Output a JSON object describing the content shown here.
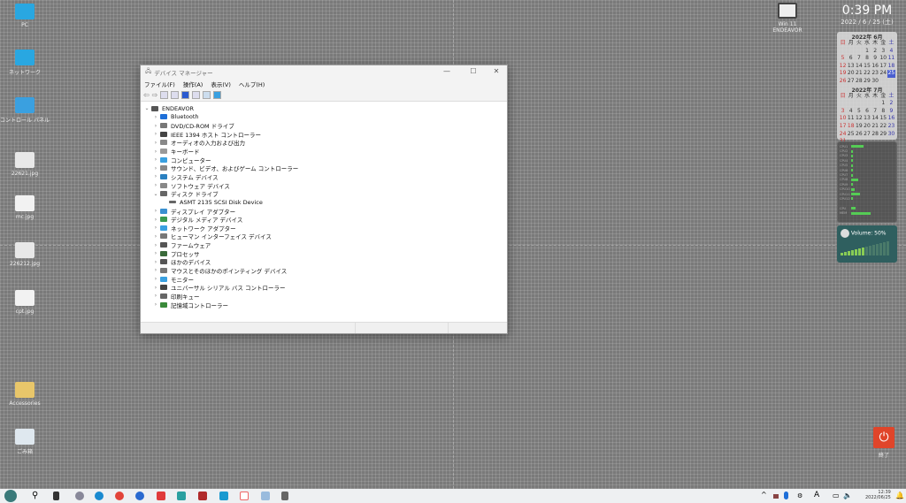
{
  "desktop": {
    "icons_left": [
      {
        "label": "PC",
        "color": "#29a7e1"
      },
      {
        "label": "ネットワーク",
        "color": "#29a7e1"
      },
      {
        "label": "コントロール パネル",
        "color": "#3aa0e0"
      },
      {
        "label": "22621.jpg",
        "color": "#e8e8e8"
      },
      {
        "label": "mc.jpg",
        "color": "#f2f2f2"
      },
      {
        "label": "226212.jpg",
        "color": "#e8e8e8"
      },
      {
        "label": "cpt.jpg",
        "color": "#f2f2f2"
      },
      {
        "label": "Accessories",
        "color": "#e8c66a"
      },
      {
        "label": "ごみ箱",
        "color": "#dfe8ef"
      }
    ],
    "icon_right": {
      "label": "Win 11 ENDEAVOR"
    },
    "power_icon": {
      "label": "終了",
      "color": "#e0452a"
    }
  },
  "window": {
    "title": "デバイス マネージャー",
    "minimize": "—",
    "maximize": "☐",
    "close": "✕",
    "menu": [
      "ファイル(F)",
      "操作(A)",
      "表示(V)",
      "ヘルプ(H)"
    ],
    "tree": {
      "root": "ENDEAVOR",
      "items": [
        {
          "label": "Bluetooth",
          "expanded": false,
          "color": "#1e6fd8"
        },
        {
          "label": "DVD/CD-ROM ドライブ",
          "expanded": false,
          "color": "#777"
        },
        {
          "label": "IEEE 1394 ホスト コントローラー",
          "expanded": false,
          "color": "#444"
        },
        {
          "label": "オーディオの入力および出力",
          "expanded": false,
          "color": "#888"
        },
        {
          "label": "キーボード",
          "expanded": false,
          "color": "#999"
        },
        {
          "label": "コンピューター",
          "expanded": false,
          "color": "#3aa0e0"
        },
        {
          "label": "サウンド、ビデオ、およびゲーム コントローラー",
          "expanded": false,
          "color": "#888"
        },
        {
          "label": "システム デバイス",
          "expanded": false,
          "color": "#2a80c0"
        },
        {
          "label": "ソフトウェア デバイス",
          "expanded": false,
          "color": "#888"
        },
        {
          "label": "ディスク ドライブ",
          "expanded": true,
          "color": "#666",
          "children": [
            "ASMT 2135 SCSI Disk Device"
          ]
        },
        {
          "label": "ディスプレイ アダプター",
          "expanded": false,
          "color": "#3a90d0"
        },
        {
          "label": "デジタル メディア デバイス",
          "expanded": false,
          "color": "#3a9a50"
        },
        {
          "label": "ネットワーク アダプター",
          "expanded": false,
          "color": "#3aa0e0"
        },
        {
          "label": "ヒューマン インターフェイス デバイス",
          "expanded": false,
          "color": "#777"
        },
        {
          "label": "ファームウェア",
          "expanded": false,
          "color": "#555"
        },
        {
          "label": "プロセッサ",
          "expanded": false,
          "color": "#3a6a3a"
        },
        {
          "label": "ほかのデバイス",
          "expanded": false,
          "color": "#555"
        },
        {
          "label": "マウスとそのほかのポインティング デバイス",
          "expanded": false,
          "color": "#777"
        },
        {
          "label": "モニター",
          "expanded": false,
          "color": "#3aa0e0"
        },
        {
          "label": "ユニバーサル シリアル バス コントローラー",
          "expanded": false,
          "color": "#444"
        },
        {
          "label": "印刷キュー",
          "expanded": false,
          "color": "#666"
        },
        {
          "label": "記憶域コントローラー",
          "expanded": false,
          "color": "#3a8a3a"
        }
      ]
    }
  },
  "clock": {
    "time": "0:39 PM",
    "date": "2022 / 6 / 25 (土)"
  },
  "calendar": {
    "weekdays": [
      "日",
      "月",
      "火",
      "水",
      "木",
      "金",
      "土"
    ],
    "today": 25,
    "months": [
      {
        "title": "2022年 6月",
        "offset": 3,
        "days": 30,
        "holidays": []
      },
      {
        "title": "2022年 7月",
        "offset": 5,
        "days": 31,
        "holidays": [
          18
        ]
      }
    ]
  },
  "cpu_meter": {
    "labels": [
      "CPU1",
      "CPU2",
      "CPU3",
      "CPU4",
      "CPU5",
      "CPU6",
      "CPU7",
      "CPU8",
      "CPU9",
      "CPU10",
      "CPU11",
      "CPU12",
      "",
      "CPU",
      "MEM"
    ],
    "levels": [
      35,
      5,
      5,
      5,
      5,
      5,
      5,
      20,
      5,
      10,
      25,
      5,
      0,
      12,
      55
    ]
  },
  "volume": {
    "label": "Volume: 50%",
    "level": 50
  },
  "taskbar": {
    "time": "12:39",
    "date": "2022/06/25"
  }
}
